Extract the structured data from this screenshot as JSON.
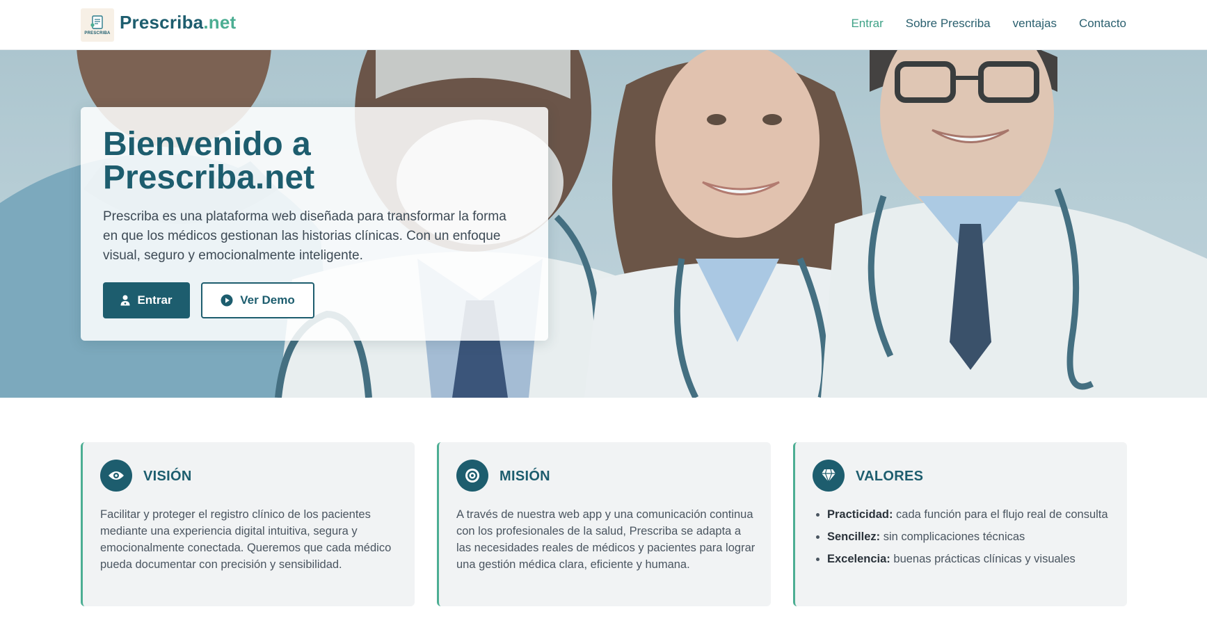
{
  "header": {
    "logo_mini": "PRESCRIBA",
    "brand_main": "Prescriba",
    "brand_tld": ".net",
    "nav": [
      {
        "label": "Entrar",
        "active": true
      },
      {
        "label": "Sobre Prescriba",
        "active": false
      },
      {
        "label": "ventajas",
        "active": false
      },
      {
        "label": "Contacto",
        "active": false
      }
    ]
  },
  "hero": {
    "title_line1": "Bienvenido a",
    "title_line2": "Prescriba.net",
    "description": "Prescriba es una plataforma web diseñada para transformar la forma en que los médicos gestionan las historias clínicas. Con un enfoque visual, seguro y emocionalmente inteligente.",
    "primary_button": {
      "label": "Entrar",
      "icon": "user-doctor-icon"
    },
    "secondary_button": {
      "label": "Ver Demo",
      "icon": "play-circle-icon"
    }
  },
  "cards": {
    "vision": {
      "icon": "eye-icon",
      "title": "VISIÓN",
      "text": "Facilitar y proteger el registro clínico de los pacientes mediante una experiencia digital intuitiva, segura y emocionalmente conectada. Queremos que cada médico pueda documentar con precisión y sensibilidad."
    },
    "mision": {
      "icon": "target-icon",
      "title": "MISIÓN",
      "text": "A través de nuestra web app y una comunicación continua con los profesionales de la salud, Prescriba se adapta a las necesidades reales de médicos y pacientes para lograr una gestión médica clara, eficiente y humana."
    },
    "valores": {
      "icon": "gem-icon",
      "title": "VALORES",
      "items": [
        {
          "term": "Practicidad:",
          "desc": " cada función para el flujo real de consulta"
        },
        {
          "term": "Sencillez:",
          "desc": " sin complicaciones técnicas"
        },
        {
          "term": "Excelencia:",
          "desc": " buenas prácticas clínicas y visuales"
        }
      ]
    }
  },
  "colors": {
    "primary": "#1d5d6e",
    "accent": "#4cae93",
    "card_bg": "#f1f3f4"
  }
}
